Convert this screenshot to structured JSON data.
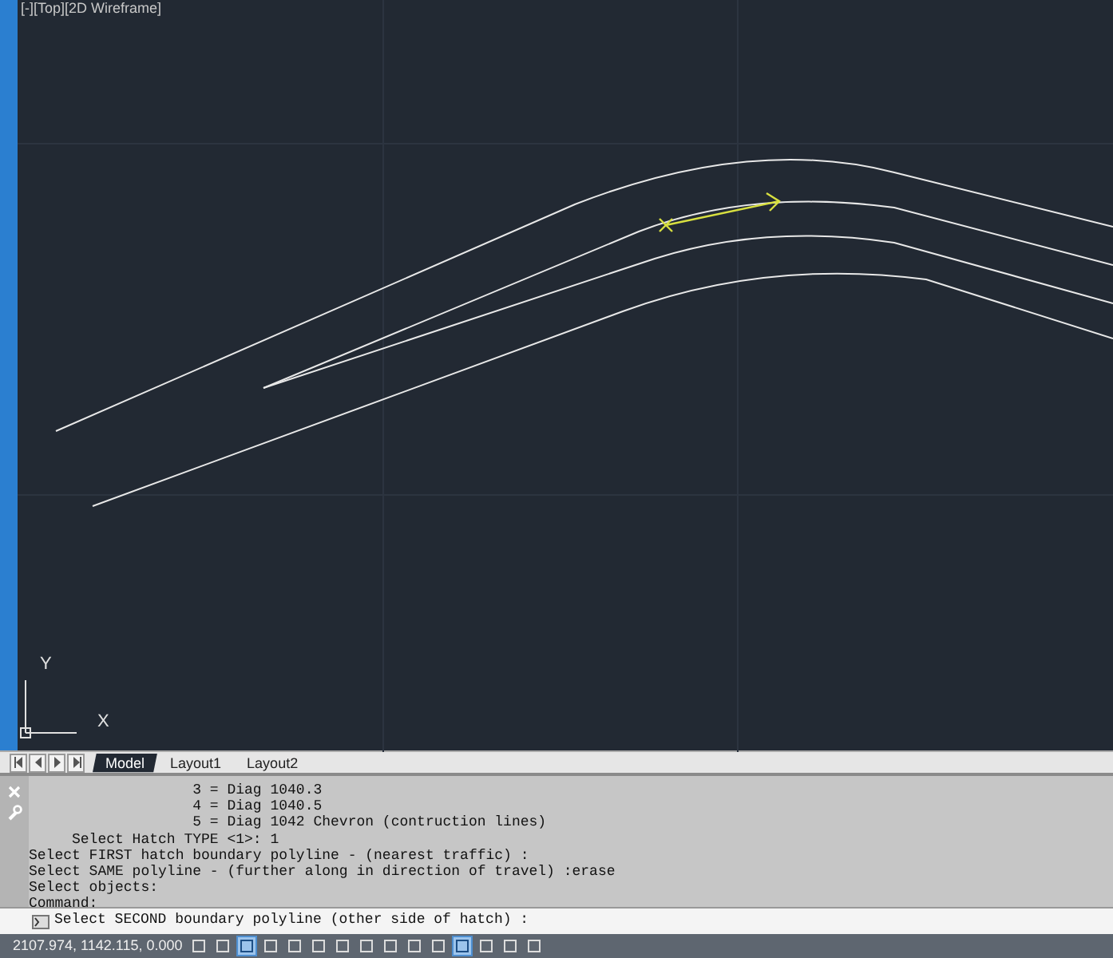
{
  "viewport": {
    "label": "[-][Top][2D Wireframe]",
    "axis_labels": [
      "Y",
      "X"
    ]
  },
  "layout_tabs": [
    {
      "label": "Model",
      "selected": true
    },
    {
      "label": "Layout1",
      "selected": false
    },
    {
      "label": "Layout2",
      "selected": false
    }
  ],
  "command_history": [
    "                   3 = Diag 1040.3",
    "                   4 = Diag 1040.5",
    "                   5 = Diag 1042 Chevron (contruction lines)",
    "     Select Hatch TYPE <1>: 1",
    "Select FIRST hatch boundary polyline - (nearest traffic) :",
    "Select SAME polyline - (further along in direction of travel) :erase",
    "Select objects:",
    "Command:"
  ],
  "command_prompt": "Select SECOND boundary polyline (other side of hatch) :",
  "status_bar": {
    "coordinates": "2107.974, 1142.115, 0.000",
    "toggles": [
      {
        "on": false
      },
      {
        "on": false
      },
      {
        "on": true
      },
      {
        "on": false
      },
      {
        "on": false
      },
      {
        "on": false
      },
      {
        "on": false
      },
      {
        "on": false
      },
      {
        "on": false
      },
      {
        "on": false
      },
      {
        "on": false
      },
      {
        "on": true
      },
      {
        "on": false
      },
      {
        "on": false
      },
      {
        "on": false
      }
    ]
  }
}
